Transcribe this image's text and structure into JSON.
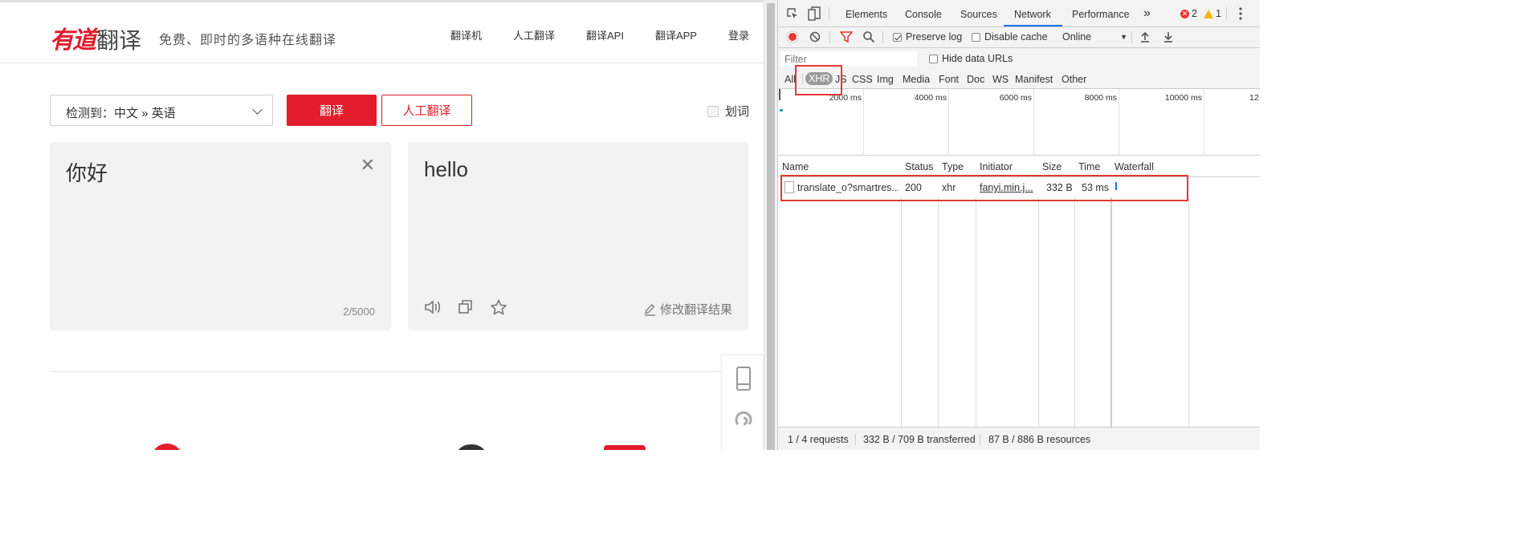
{
  "youdao": {
    "logo_red": "有道",
    "logo_gray": "翻译",
    "slogan": "免费、即时的多语种在线翻译",
    "nav": [
      "翻译机",
      "人工翻译",
      "翻译API",
      "翻译APP",
      "登录"
    ],
    "lang_select": "检测到：中文 » 英语",
    "translate_button": "翻译",
    "human_button": "人工翻译",
    "huaci_label": "划词",
    "source_text": "你好",
    "char_count": "2/5000",
    "result_text": "hello",
    "edit_result": "修改翻译结果",
    "accent_color": "#e31d2d"
  },
  "devtools": {
    "tabs": [
      "Elements",
      "Console",
      "Sources",
      "Network",
      "Performance"
    ],
    "active_tab": "Network",
    "more_tabs": "»",
    "errors": "2",
    "warnings": "1",
    "preserve_log": "Preserve log",
    "disable_cache": "Disable cache",
    "throttle": "Online",
    "filter_placeholder": "Filter",
    "hide_data_urls": "Hide data URLs",
    "types": [
      "All",
      "XHR",
      "JS",
      "CSS",
      "Img",
      "Media",
      "Font",
      "Doc",
      "WS",
      "Manifest",
      "Other"
    ],
    "selected_type": "XHR",
    "timeline_labels": [
      "2000 ms",
      "4000 ms",
      "6000 ms",
      "8000 ms",
      "10000 ms",
      "12"
    ],
    "columns": [
      "Name",
      "Status",
      "Type",
      "Initiator",
      "Size",
      "Time",
      "Waterfall"
    ],
    "rows": [
      {
        "name": "translate_o?smartres...",
        "status": "200",
        "type": "xhr",
        "initiator": "fanyi.min.j...",
        "size": "332 B",
        "time": "53 ms"
      }
    ],
    "status": {
      "requests": "1 / 4 requests",
      "transferred": "332 B / 709 B transferred",
      "resources": "87 B / 886 B resources"
    }
  }
}
